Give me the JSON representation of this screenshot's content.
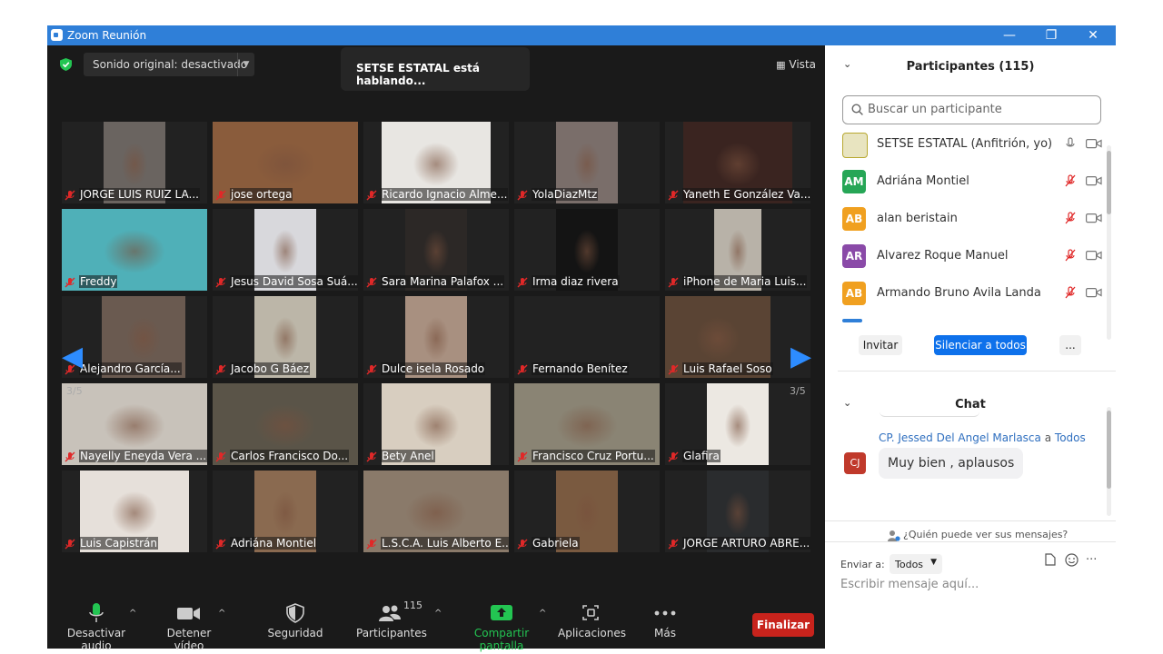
{
  "window": {
    "title": "Zoom Reunión",
    "minimize": "—",
    "restore": "❐",
    "close": "✕"
  },
  "top": {
    "sound": "Sonido original: desactivado",
    "speaking": "SETSE ESTATAL está hablando...",
    "view": "Vista"
  },
  "grid": {
    "page_left": "3/5",
    "page_right": "3/5",
    "tiles": [
      {
        "name": "JORGE LUIS RUIZ LA...",
        "bg": "#6a6460"
      },
      {
        "name": "jose ortega",
        "bg": "#8a5c3c"
      },
      {
        "name": "Ricardo Ignacio Alme...",
        "bg": "#e8e6e2"
      },
      {
        "name": "YolaDiazMtz",
        "bg": "#7a6e6a"
      },
      {
        "name": "Yaneth E González Va...",
        "bg": "#3a2420"
      },
      {
        "name": "Freddy",
        "bg": "#4fb0b8"
      },
      {
        "name": "Jesus David Sosa Suá...",
        "bg": "#d8d8dc"
      },
      {
        "name": "Sara Marina Palafox ...",
        "bg": "#2c2826"
      },
      {
        "name": "Irma diaz rivera",
        "bg": "#141414"
      },
      {
        "name": "iPhone de Maria Luis...",
        "bg": "#b8b2a8"
      },
      {
        "name": "Alejandro García...",
        "bg": "#6a5a50"
      },
      {
        "name": "Jacobo G Báez",
        "bg": "#bcb6a8"
      },
      {
        "name": "Dulce isela Rosado",
        "bg": "#a89080"
      },
      {
        "name": "Fernando Benítez",
        "bg": "#222222"
      },
      {
        "name": "Luis Rafael Soso",
        "bg": "#5a4434"
      },
      {
        "name": "Nayelly Eneyda Vera ...",
        "bg": "#c8c2ba"
      },
      {
        "name": "Carlos Francisco Do...",
        "bg": "#5a5448"
      },
      {
        "name": "Bety Anel",
        "bg": "#d8cec0"
      },
      {
        "name": "Francisco Cruz Portu...",
        "bg": "#8a8474"
      },
      {
        "name": "Glafira",
        "bg": "#ece8e2"
      },
      {
        "name": "Luis Capistrán",
        "bg": "#e6e0da"
      },
      {
        "name": "Adriána Montiel",
        "bg": "#8a6a50"
      },
      {
        "name": "L.S.C.A. Luis Alberto E...",
        "bg": "#8a7a6a"
      },
      {
        "name": "Gabriela",
        "bg": "#7a5a40"
      },
      {
        "name": "JORGE ARTURO ABRE...",
        "bg": "#2a2c2e"
      }
    ]
  },
  "toolbar": {
    "mute": "Desactivar audio",
    "video": "Detener vídeo",
    "security": "Seguridad",
    "participants": "Participantes",
    "participants_count": "115",
    "share": "Compartir pantalla",
    "apps": "Aplicaciones",
    "more": "Más",
    "end": "Finalizar"
  },
  "panel": {
    "participants_title": "Participantes (115)",
    "search_placeholder": "Buscar un participante",
    "participants": [
      {
        "initials": "",
        "name": "SETSE ESTATAL (Anfitrión, yo)",
        "color": "#e8e4c0",
        "muted": false
      },
      {
        "initials": "AM",
        "name": "Adriána Montiel",
        "color": "#26a656",
        "muted": true
      },
      {
        "initials": "AB",
        "name": "alan beristain",
        "color": "#f0a020",
        "muted": true
      },
      {
        "initials": "AR",
        "name": "Alvarez Roque Manuel",
        "color": "#8a4aa8",
        "muted": true
      },
      {
        "initials": "AB",
        "name": "Armando Bruno Avila Landa",
        "color": "#f0a020",
        "muted": true
      }
    ],
    "invite": "Invitar",
    "mute_all": "Silenciar a todos",
    "more": "...",
    "chat_title": "Chat",
    "chat": {
      "sender": "CP. Jessed  Del Angel Marlasca",
      "to_word": "a",
      "to": "Todos",
      "avatar": "CJ",
      "message": "Muy bien , aplausos"
    },
    "who_sees": "¿Quién puede ver sus mensajes?",
    "send_to_label": "Enviar a:",
    "send_to_value": "Todos",
    "input_placeholder": "Escribir mensaje aquí..."
  },
  "colors": {
    "accent": "#2d8cff",
    "titlebar": "#2f7fd8",
    "end": "#c8231c",
    "share": "#23c552"
  }
}
